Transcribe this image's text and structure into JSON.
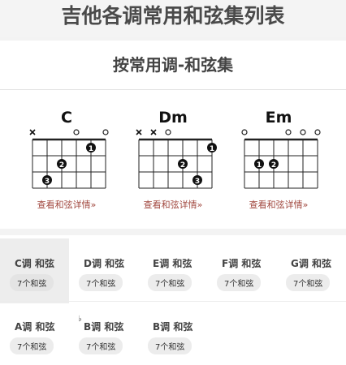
{
  "header": {
    "title": "吉他各调常用和弦集列表"
  },
  "section": {
    "title": "按常用调-和弦集"
  },
  "chords": [
    {
      "name": "C",
      "link": "查看和弦详情»"
    },
    {
      "name": "Dm",
      "link": "查看和弦详情»"
    },
    {
      "name": "Em",
      "link": "查看和弦详情»"
    }
  ],
  "keys": [
    {
      "label": "C调 和弦",
      "count": "7个和弦",
      "active": true
    },
    {
      "label": "D调 和弦",
      "count": "7个和弦"
    },
    {
      "label": "E调 和弦",
      "count": "7个和弦"
    },
    {
      "label": "F调 和弦",
      "count": "7个和弦"
    },
    {
      "label": "G调 和弦",
      "count": "7个和弦"
    },
    {
      "label": "A调 和弦",
      "count": "7个和弦"
    },
    {
      "label": "B调 和弦",
      "flat": "♭",
      "count": "7个和弦"
    },
    {
      "label": "B调 和弦",
      "count": "7个和弦"
    }
  ],
  "fingers": {
    "one": "1",
    "two": "2",
    "three": "3"
  },
  "colors": {
    "link": "#a0463d",
    "accent": "#111111"
  }
}
